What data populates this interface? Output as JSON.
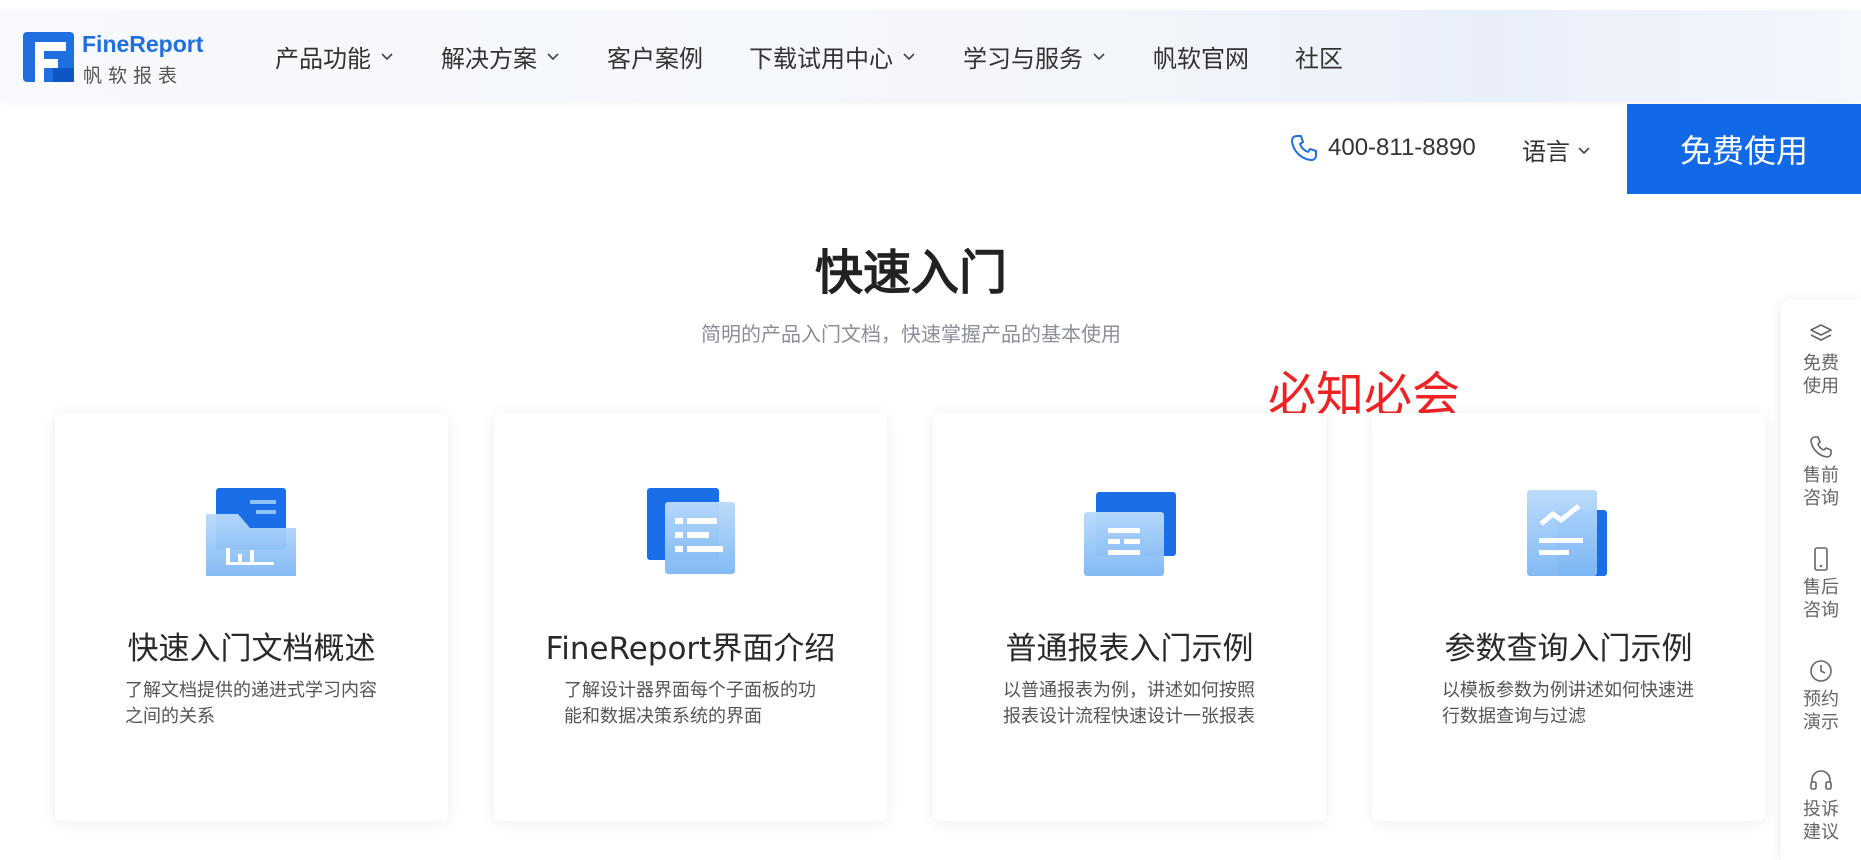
{
  "header": {
    "logo": {
      "name_en": "FineReport",
      "name_cn": "帆软报表"
    },
    "nav": [
      {
        "label": "产品功能",
        "has_dropdown": true
      },
      {
        "label": "解决方案",
        "has_dropdown": true
      },
      {
        "label": "客户案例",
        "has_dropdown": false
      },
      {
        "label": "下载试用中心",
        "has_dropdown": true
      },
      {
        "label": "学习与服务",
        "has_dropdown": true
      },
      {
        "label": "帆软官网",
        "has_dropdown": false
      },
      {
        "label": "社区",
        "has_dropdown": false
      }
    ]
  },
  "subbar": {
    "phone_icon": "phone-icon",
    "phone": "400-811-8890",
    "language_label": "语言",
    "cta_label": "免费使用"
  },
  "main": {
    "title": "快速入门",
    "subtitle": "简明的产品入门文档，快速掌握产品的基本使用",
    "annotation": "必知必会",
    "cards": [
      {
        "title": "快速入门文档概述",
        "desc": "了解文档提供的递进式学习内容之间的关系",
        "icon": "document-chart-icon"
      },
      {
        "title": "FineReport界面介绍",
        "desc": "了解设计器界面每个子面板的功能和数据决策系统的界面",
        "icon": "interface-list-icon"
      },
      {
        "title": "普通报表入门示例",
        "desc": "以普通报表为例，讲述如何按照报表设计流程快速设计一张报表",
        "icon": "report-table-icon"
      },
      {
        "title": "参数查询入门示例",
        "desc": "以模板参数为例讲述如何快速进行数据查询与过滤",
        "icon": "parameter-query-icon"
      }
    ]
  },
  "sidebar": {
    "items": [
      {
        "label": "免费使用",
        "icon": "layers-icon"
      },
      {
        "label": "售前咨询",
        "icon": "phone-icon"
      },
      {
        "label": "售后咨询",
        "icon": "mobile-icon"
      },
      {
        "label": "预约演示",
        "icon": "clock-icon"
      },
      {
        "label": "投诉建议",
        "icon": "headset-icon"
      }
    ]
  },
  "colors": {
    "brand_blue": "#1169e7",
    "annotation_red": "#ee2222"
  }
}
